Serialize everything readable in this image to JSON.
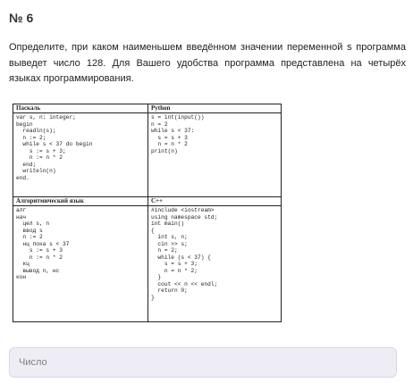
{
  "header": {
    "title": "№ 6"
  },
  "task": {
    "text": "Определите, при каком наименьшем введённом значении переменной s программа выведет число 128. Для Вашего удобства программа представлена на четырёх языках программирования."
  },
  "table": {
    "pascal_label": "Паскаль",
    "python_label": "Python",
    "algo_label": "Алгоритмический язык",
    "cpp_label": "C++",
    "pascal_code": "var s, n: integer;\nbegin\n  readln(s);\n  n := 2;\n  while s < 37 do begin\n    s := s + 3;\n    n := n * 2\n  end;\n  writeln(n)\nend.",
    "python_code": "s = int(input())\nn = 2\nwhile s < 37:\n  s = s + 3\n  n = n * 2\nprint(n)",
    "algo_code": "алг\nнач\n  цел s, n\n  ввод s\n  n := 2\n  нц пока s < 37\n    s := s + 3\n    n := n * 2\n  кц\n  вывод n, нс\nкон",
    "cpp_code": "#include <iostream>\nusing namespace std;\nint main()\n{\n  int s, n;\n  cin >> s;\n  n = 2;\n  while (s < 37) {\n    s = s + 3;\n    n = n * 2;\n  }\n  cout << n << endl;\n  return 0;\n}"
  },
  "answer": {
    "placeholder": "Число"
  }
}
